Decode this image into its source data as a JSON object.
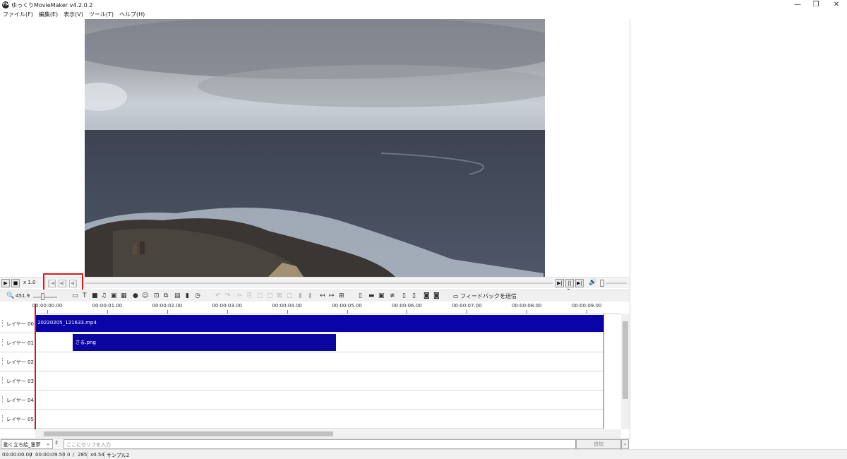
{
  "window": {
    "title": "ゆっくりMovieMaker v4.2.0.2",
    "logo_text": "YM",
    "minimize": "—",
    "restore": "❐",
    "close": "✕"
  },
  "menu": [
    "ファイル(F)",
    "編集(E)",
    "表示(V)",
    "ツール(T)",
    "ヘルプ(H)"
  ],
  "transport": {
    "play_icon": "▶",
    "stop_icon": "■",
    "speed": "x 1.0",
    "first_frame_icon": "|◀",
    "prev_frame_icon": "◀||",
    "prev_icon": "◀|",
    "right_buttons": [
      "▶|",
      "||▶",
      "▶|"
    ],
    "volume_icon": "🔊"
  },
  "toolbar": {
    "zoom_value": "451.9",
    "feedback_label": "フィードバックを送信"
  },
  "timeline": {
    "ticks": [
      "00:00:00.00",
      "00:00:01.00",
      "00:00:02.00",
      "00:00:03.00",
      "00:00:04.00",
      "00:00:05.00",
      "00:00:06.00",
      "00:00:07.00",
      "00:00:08.00",
      "00:00:09.00"
    ],
    "layers": [
      "レイヤー 00",
      "レイヤー 01",
      "レイヤー 02",
      "レイヤー 03",
      "レイヤー 04",
      "レイヤー 05"
    ],
    "clips": [
      {
        "name": "20220205_121633.mp4",
        "layer": 0,
        "start": 0,
        "end": 9.5,
        "color": "#0a04a8"
      },
      {
        "name": "さる.png",
        "layer": 1,
        "start": 0.63,
        "end": 5.03,
        "color": "#0b06a0"
      }
    ],
    "duration_seconds": 9.5
  },
  "input": {
    "character": "動く立ち絵_霊夢",
    "character_arrow": "⌄",
    "placeholder": "ここにセリフを入力",
    "add_label": "追加",
    "add_arrow": "⌄"
  },
  "status": {
    "time": "00:00:00.00",
    "slash1": "/",
    "duration": "00:00:09.50",
    "frame": "0",
    "slash2": "/",
    "total_frames": "285",
    "zoom": "x0.54",
    "project": "サンプル2"
  },
  "colors": {
    "accent_red": "#e8161c",
    "clip_blue": "#0a04a8",
    "playhead": "#cc1a1a"
  }
}
